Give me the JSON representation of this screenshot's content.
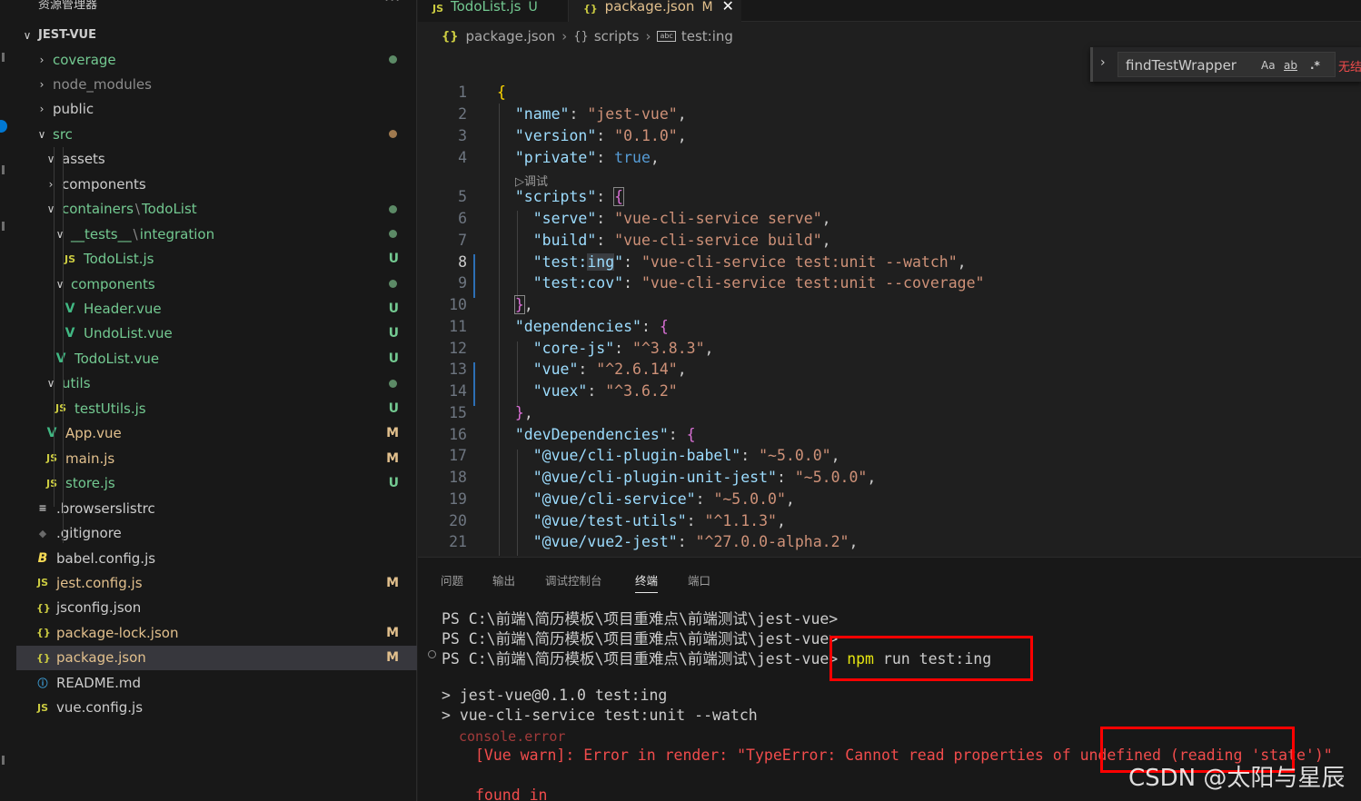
{
  "colors": {
    "git_modified": "#e2c08d",
    "git_untracked": "#73c991",
    "error_red": "#f14c4c",
    "highlight_box": "#ff0000",
    "accent": "#0078d4"
  },
  "explorer": {
    "title": "资源管理器",
    "more": "···",
    "root": "JEST-VUE",
    "items": [
      {
        "label": "coverage",
        "type": "folder",
        "icon": "chevron-right-icon",
        "status": "",
        "dot": true,
        "color": "#73c991"
      },
      {
        "label": "node_modules",
        "type": "folder",
        "icon": "chevron-right-icon",
        "status": "",
        "dot": false,
        "color": "#8c8c8c"
      },
      {
        "label": "public",
        "type": "folder",
        "icon": "chevron-right-icon",
        "status": "",
        "dot": false,
        "color": "#cccccc"
      },
      {
        "label": "src",
        "type": "folder",
        "icon": "chevron-down-icon",
        "status": "",
        "dot": true,
        "color": "#73c991"
      },
      {
        "label": "assets",
        "type": "folder",
        "icon": "chevron-down-icon",
        "status": "",
        "dot": false,
        "color": "#cccccc"
      },
      {
        "label": "components",
        "type": "folder",
        "icon": "chevron-right-icon",
        "status": "",
        "dot": false,
        "color": "#cccccc"
      },
      {
        "label": "containers",
        "label2": "TodoList",
        "type": "folder",
        "icon": "chevron-down-icon",
        "status": "",
        "dot": true,
        "color": "#73c991"
      },
      {
        "label": "__tests__",
        "label2": "integration",
        "type": "folder",
        "icon": "chevron-down-icon",
        "status": "",
        "dot": true,
        "color": "#73c991"
      },
      {
        "label": "TodoList.js",
        "type": "js",
        "icon": "js-file-icon",
        "status": "U",
        "dot": false,
        "color": "#73c991"
      },
      {
        "label": "components",
        "type": "folder",
        "icon": "chevron-down-icon",
        "status": "",
        "dot": true,
        "color": "#73c991"
      },
      {
        "label": "Header.vue",
        "type": "vue",
        "icon": "vue-file-icon",
        "status": "U",
        "dot": false,
        "color": "#73c991"
      },
      {
        "label": "UndoList.vue",
        "type": "vue",
        "icon": "vue-file-icon",
        "status": "U",
        "dot": false,
        "color": "#73c991"
      },
      {
        "label": "TodoList.vue",
        "type": "vue",
        "icon": "vue-file-icon",
        "status": "U",
        "dot": false,
        "color": "#73c991"
      },
      {
        "label": "utils",
        "type": "folder",
        "icon": "chevron-down-icon",
        "status": "",
        "dot": true,
        "color": "#73c991"
      },
      {
        "label": "testUtils.js",
        "type": "js",
        "icon": "js-file-icon",
        "status": "U",
        "dot": false,
        "color": "#73c991"
      },
      {
        "label": "App.vue",
        "type": "vue",
        "icon": "vue-file-icon",
        "status": "M",
        "dot": false,
        "color": "#e2c08d"
      },
      {
        "label": "main.js",
        "type": "js",
        "icon": "js-file-icon",
        "status": "M",
        "dot": false,
        "color": "#e2c08d"
      },
      {
        "label": "store.js",
        "type": "js",
        "icon": "js-file-icon",
        "status": "U",
        "dot": false,
        "color": "#73c991"
      },
      {
        "label": ".browserslistrc",
        "type": "text",
        "icon": "lines-file-icon",
        "status": "",
        "dot": false,
        "color": "#cccccc"
      },
      {
        "label": ".gitignore",
        "type": "git",
        "icon": "git-file-icon",
        "status": "",
        "dot": false,
        "color": "#cccccc"
      },
      {
        "label": "babel.config.js",
        "type": "babel",
        "icon": "babel-file-icon",
        "status": "",
        "dot": false,
        "color": "#cccccc"
      },
      {
        "label": "jest.config.js",
        "type": "js",
        "icon": "js-file-icon",
        "status": "M",
        "dot": false,
        "color": "#e2c08d"
      },
      {
        "label": "jsconfig.json",
        "type": "json",
        "icon": "json-file-icon",
        "status": "",
        "dot": false,
        "color": "#cccccc"
      },
      {
        "label": "package-lock.json",
        "type": "json",
        "icon": "json-file-icon",
        "status": "M",
        "dot": false,
        "color": "#e2c08d"
      },
      {
        "label": "package.json",
        "type": "json",
        "icon": "json-file-icon",
        "status": "M",
        "dot": false,
        "color": "#e2c08d"
      },
      {
        "label": "README.md",
        "type": "info",
        "icon": "info-file-icon",
        "status": "",
        "dot": false,
        "color": "#cccccc"
      },
      {
        "label": "vue.config.js",
        "type": "js",
        "icon": "js-file-icon",
        "status": "",
        "dot": false,
        "color": "#cccccc"
      }
    ]
  },
  "tabs": [
    {
      "icon_text": "JS",
      "label": "TodoList.js",
      "status": "U",
      "active": false
    },
    {
      "icon_text": "{}",
      "label": "package.json",
      "status": "M",
      "active": true
    }
  ],
  "breadcrumb": {
    "file": "package.json",
    "section": "scripts",
    "key": "test:ing",
    "abc": "abc"
  },
  "find": {
    "value": "findTestWrapper",
    "match_case": "Aa",
    "whole_word": "ab",
    "regex": ".*",
    "result": "无结果"
  },
  "editor": {
    "codelens": "▷调试",
    "lines": [
      "1",
      "2",
      "3",
      "4",
      "5",
      "6",
      "7",
      "8",
      "9",
      "10",
      "11",
      "12",
      "13",
      "14",
      "15",
      "16",
      "17",
      "18",
      "19",
      "20",
      "21"
    ],
    "current_line": "8",
    "code": {
      "name_key": "\"name\"",
      "name_val": "\"jest-vue\"",
      "version_key": "\"version\"",
      "version_val": "\"0.1.0\"",
      "private_key": "\"private\"",
      "private_val": "true",
      "scripts_key": "\"scripts\"",
      "serve_key": "\"serve\"",
      "serve_val": "\"vue-cli-service serve\"",
      "build_key": "\"build\"",
      "build_val": "\"vue-cli-service build\"",
      "testing_key_a": "\"test:",
      "testing_key_b": "ing",
      "testing_key_c": "\"",
      "testing_val": "\"vue-cli-service test:unit --watch\"",
      "testcov_key": "\"test:cov\"",
      "testcov_val": "\"vue-cli-service test:unit --coverage\"",
      "deps_key": "\"dependencies\"",
      "corejs_key": "\"core-js\"",
      "corejs_val": "\"^3.8.3\"",
      "vue_key": "\"vue\"",
      "vue_val": "\"^2.6.14\"",
      "vuex_key": "\"vuex\"",
      "vuex_val": "\"^3.6.2\"",
      "devdeps_key": "\"devDependencies\"",
      "babel_key": "\"@vue/cli-plugin-babel\"",
      "babel_val": "\"~5.0.0\"",
      "unitjest_key": "\"@vue/cli-plugin-unit-jest\"",
      "unitjest_val": "\"~5.0.0\"",
      "service_key": "\"@vue/cli-service\"",
      "service_val": "\"~5.0.0\"",
      "testutils_key": "\"@vue/test-utils\"",
      "testutils_val": "\"^1.1.3\"",
      "vue2jest_key": "\"@vue/vue2-jest\"",
      "vue2jest_val": "\"^27.0.0-alpha.2\""
    }
  },
  "panel": {
    "tabs": [
      "问题",
      "输出",
      "调试控制台",
      "终端",
      "端口"
    ],
    "active_tab": "终端",
    "terminal": {
      "prompt1": "PS C:\\前端\\简历模板\\项目重难点\\前端测试\\jest-vue>",
      "prompt2": "PS C:\\前端\\简历模板\\项目重难点\\前端测试\\jest-vue>",
      "prompt3": "PS C:\\前端\\简历模板\\项目重难点\\前端测试\\jest-vue>",
      "cmd_npm": "npm",
      "cmd_rest": " run test:ing",
      "out1": "> jest-vue@0.1.0 test:ing",
      "out2": "> vue-cli-service test:unit --watch",
      "console_error": "console.error",
      "warn": "[Vue warn]: Error in render: \"TypeError: Cannot read properties of undefined (reading 'state')\"",
      "found_in": "found in"
    }
  },
  "watermark": "CSDN @太阳与星辰"
}
